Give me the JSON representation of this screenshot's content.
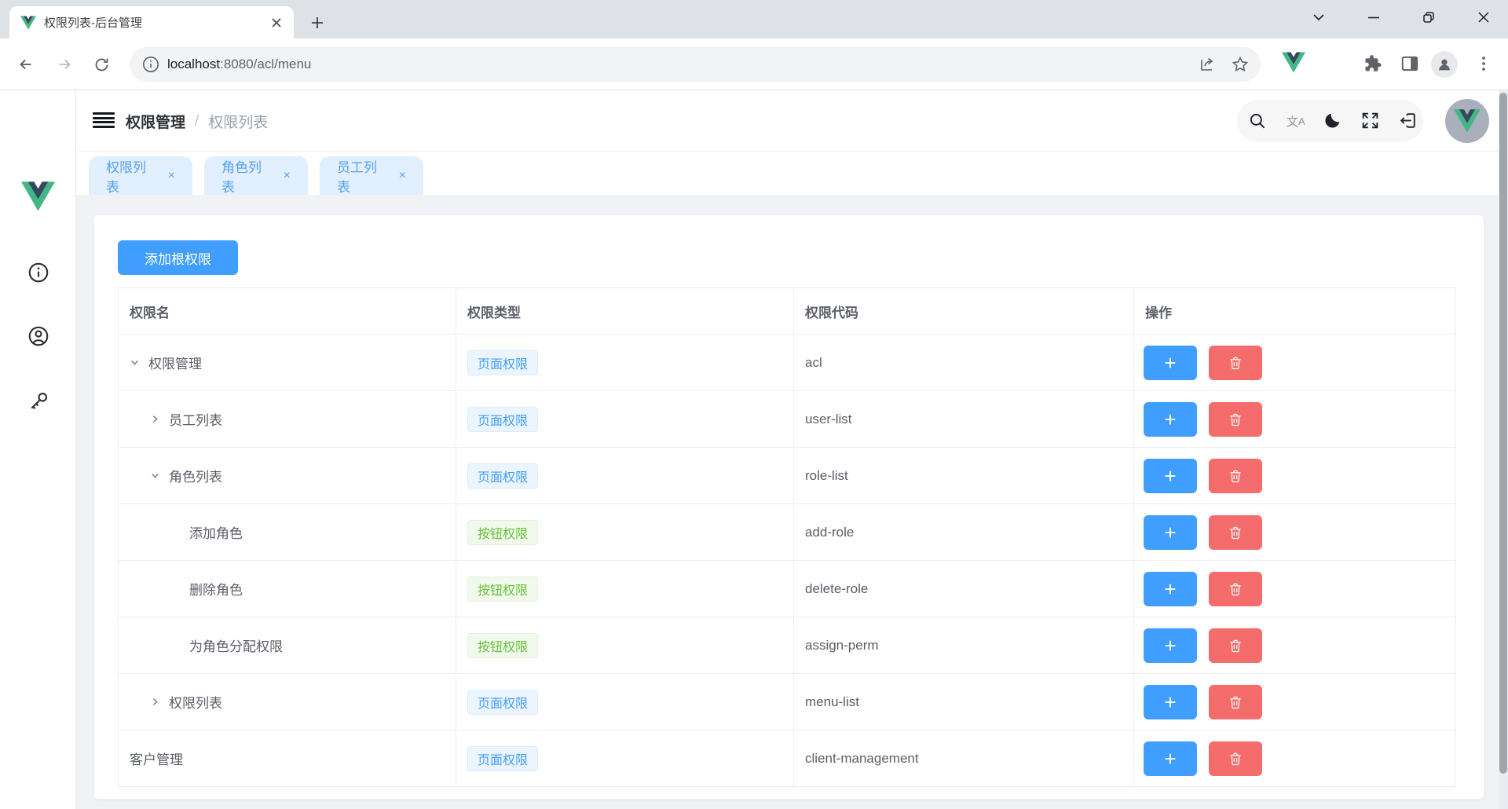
{
  "browser": {
    "tab": {
      "title": "权限列表-后台管理"
    },
    "url": {
      "host": "localhost",
      "path": ":8080/acl/menu"
    }
  },
  "app": {
    "breadcrumb": {
      "section": "权限管理",
      "separator": "/",
      "current": "权限列表"
    },
    "nav_tabs": [
      {
        "label": "权限列表",
        "close": "×"
      },
      {
        "label": "角色列表",
        "close": "×"
      },
      {
        "label": "员工列表",
        "close": "×"
      }
    ],
    "page": {
      "add_root_button": "添加根权限",
      "table": {
        "columns": [
          "权限名",
          "权限类型",
          "权限代码",
          "操作"
        ],
        "plus_glyph": "+",
        "rows": [
          {
            "name": "权限管理",
            "level": 1,
            "expand": "expanded",
            "tag": "页面权限",
            "tag_type": "page",
            "code": "acl"
          },
          {
            "name": "员工列表",
            "level": 2,
            "expand": "collapsed",
            "tag": "页面权限",
            "tag_type": "page",
            "code": "user-list"
          },
          {
            "name": "角色列表",
            "level": 2,
            "expand": "expanded",
            "tag": "页面权限",
            "tag_type": "page",
            "code": "role-list"
          },
          {
            "name": "添加角色",
            "level": 3,
            "expand": "none",
            "tag": "按钮权限",
            "tag_type": "button",
            "code": "add-role"
          },
          {
            "name": "删除角色",
            "level": 3,
            "expand": "none",
            "tag": "按钮权限",
            "tag_type": "button",
            "code": "delete-role"
          },
          {
            "name": "为角色分配权限",
            "level": 3,
            "expand": "none",
            "tag": "按钮权限",
            "tag_type": "button",
            "code": "assign-perm"
          },
          {
            "name": "权限列表",
            "level": 2,
            "expand": "collapsed",
            "tag": "页面权限",
            "tag_type": "page",
            "code": "menu-list"
          },
          {
            "name": "客户管理",
            "level": 1,
            "expand": "none",
            "tag": "页面权限",
            "tag_type": "page",
            "code": "client-management"
          }
        ]
      }
    },
    "colors": {
      "primary": "#409eff",
      "danger": "#f56c6c",
      "success": "#67c23a",
      "tag_blue_bg": "#ecf5ff",
      "tag_green_bg": "#f0f9eb",
      "chip_bg": "#e2effe",
      "chip_text": "#59a1f5",
      "page_bg": "#f0f2f5"
    }
  }
}
